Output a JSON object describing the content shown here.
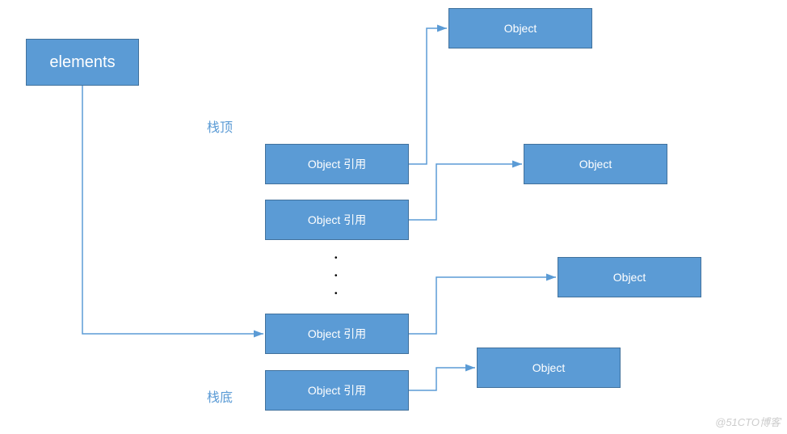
{
  "diagram": {
    "elements_label": "elements",
    "stack_top_label": "栈顶",
    "stack_bottom_label": "栈底",
    "ref_label_1": "Object 引用",
    "ref_label_2": "Object 引用",
    "ref_label_3": "Object 引用",
    "ref_label_4": "Object 引用",
    "obj_label_1": "Object",
    "obj_label_2": "Object",
    "obj_label_3": "Object",
    "obj_label_4": "Object"
  },
  "watermark": "@51CTO博客"
}
